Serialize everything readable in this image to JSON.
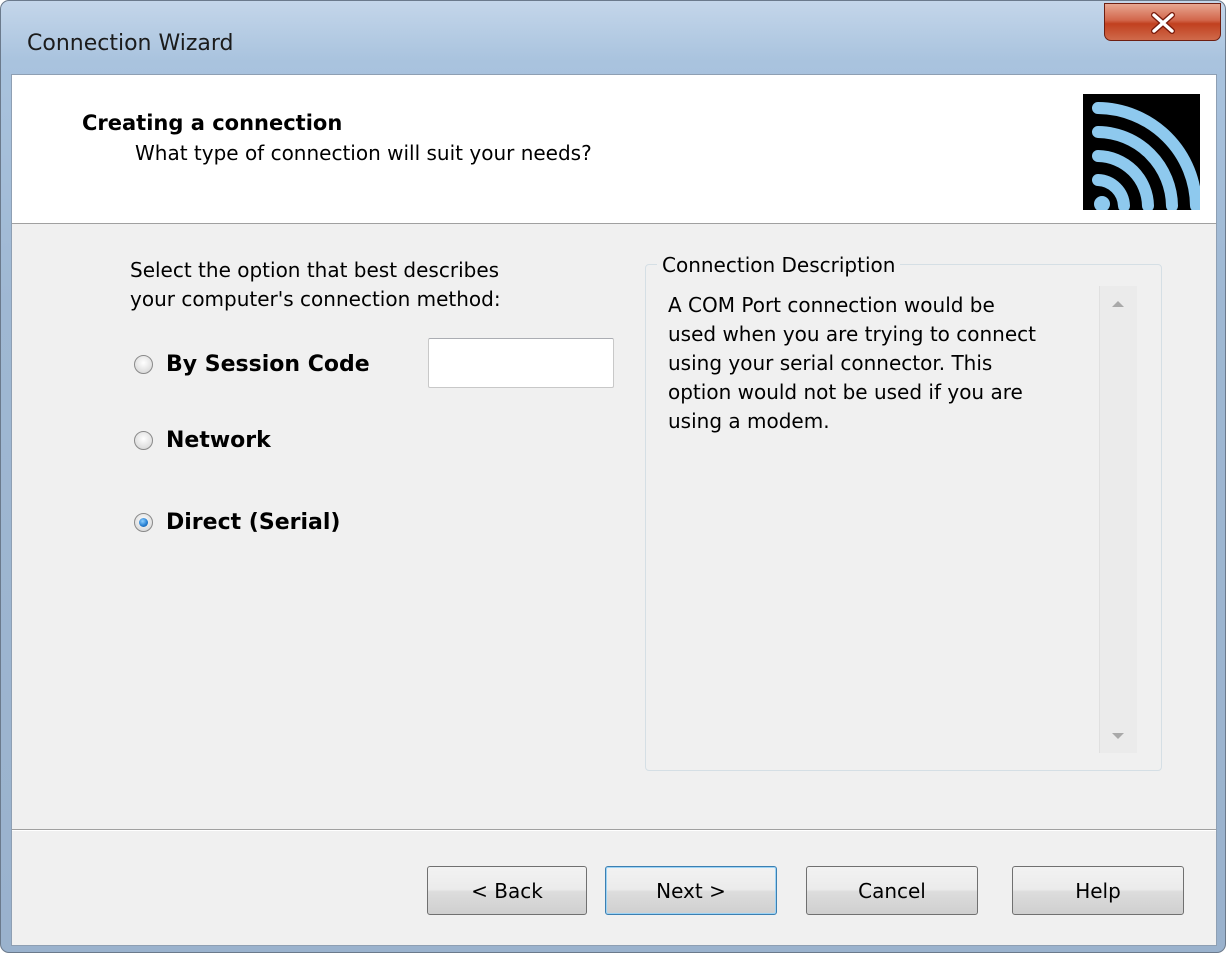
{
  "window": {
    "title": "Connection Wizard"
  },
  "header": {
    "title": "Creating a connection",
    "subtitle": "What type of connection will suit your needs?",
    "logo_icon": "signal-waves-icon"
  },
  "prompt": {
    "line1": "Select the option that best describes",
    "line2": "your computer's connection method:"
  },
  "options": [
    {
      "label": "By Session Code",
      "selected": false
    },
    {
      "label": "Network",
      "selected": false
    },
    {
      "label": "Direct (Serial)",
      "selected": true
    }
  ],
  "session_code_input": {
    "value": ""
  },
  "description": {
    "legend": "Connection Description",
    "lines": [
      "A COM Port connection would be",
      "used when you are trying to connect",
      "using your serial connector. This",
      "option would not be used if you are",
      "using a modem."
    ]
  },
  "buttons": {
    "back": "< Back",
    "next": "Next >",
    "cancel": "Cancel",
    "help": "Help"
  },
  "colors": {
    "selected_radio": "#2a82d4",
    "close_button": "#c1401f",
    "logo_waves": "#8ec9ee"
  }
}
